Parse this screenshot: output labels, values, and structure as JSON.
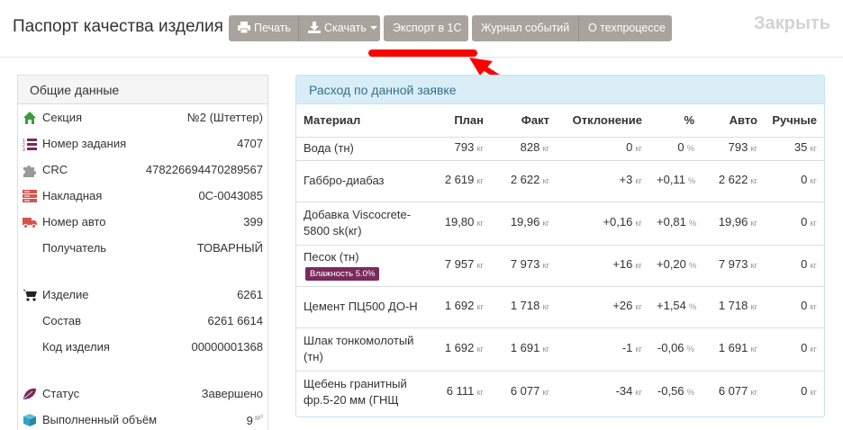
{
  "header": {
    "title": "Паспорт качества изделия",
    "print_label": "Печать",
    "download_label": "Скачать",
    "export_label": "Экспорт в 1С",
    "journal_label": "Журнал событий",
    "about_label": "О техпроцессе",
    "close_label": "Закрыть"
  },
  "general": {
    "title": "Общие данные",
    "rows": [
      {
        "label": "Секция",
        "value": "№2 (Штеттер)",
        "icon": "home-icon"
      },
      {
        "label": "Номер задания",
        "value": "4707",
        "icon": "numbered-list-icon"
      },
      {
        "label": "CRC",
        "value": "478226694470289567",
        "icon": "puzzle-icon"
      },
      {
        "label": "Накладная",
        "value": "0С-0043085",
        "icon": "server-icon"
      },
      {
        "label": "Номер авто",
        "value": "399",
        "icon": "truck-icon"
      },
      {
        "label": "Получатель",
        "value": "ТОВАРНЫЙ",
        "icon": ""
      },
      {
        "label": "Изделие",
        "value": "6261",
        "icon": "cart-icon"
      },
      {
        "label": "Состав",
        "value": "6261 6614",
        "icon": ""
      },
      {
        "label": "Код изделия",
        "value": "00000001368",
        "icon": ""
      },
      {
        "label": "Статус",
        "value": "Завершено",
        "icon": "leaf-icon"
      },
      {
        "label": "Выполненный объём",
        "value": "9",
        "unit": "м³",
        "icon": "cube-icon"
      }
    ]
  },
  "consumption": {
    "title": "Расход по данной заявке",
    "columns": [
      "Материал",
      "План",
      "Факт",
      "Отклонение",
      "%",
      "Авто",
      "Ручные"
    ],
    "unit": "кг",
    "pct_unit": "%",
    "rows": [
      {
        "name": "Вода (тн)",
        "badge": "",
        "plan": "793",
        "fact": "828",
        "dev": "0",
        "pct": "0",
        "auto": "793",
        "manual": "35"
      },
      {
        "name": "Габбро-диабаз",
        "badge": "",
        "plan": "2 619",
        "fact": "2 622",
        "dev": "+3",
        "pct": "+0,11",
        "auto": "2 622",
        "manual": "0"
      },
      {
        "name": "Добавка Viscocrete-5800 sk(кг)",
        "badge": "",
        "plan": "19,80",
        "fact": "19,96",
        "dev": "+0,16",
        "pct": "+0,81",
        "auto": "19,96",
        "manual": "0"
      },
      {
        "name": "Песок (тн)",
        "badge": "Влажность 5.0%",
        "plan": "7 957",
        "fact": "7 973",
        "dev": "+16",
        "pct": "+0,20",
        "auto": "7 973",
        "manual": "0"
      },
      {
        "name": "Цемент ПЦ500 ДО-Н",
        "badge": "",
        "plan": "1 692",
        "fact": "1 718",
        "dev": "+26",
        "pct": "+1,54",
        "auto": "1 718",
        "manual": "0"
      },
      {
        "name": "Шлак тонкомолотый (тн)",
        "badge": "",
        "plan": "1 692",
        "fact": "1 691",
        "dev": "-1",
        "pct": "-0,06",
        "auto": "1 691",
        "manual": "0"
      },
      {
        "name": "Щебень гранитный фр.5-20 мм (ГНЩ",
        "badge": "",
        "plan": "6 111",
        "fact": "6 077",
        "dev": "-34",
        "pct": "-0,56",
        "auto": "6 077",
        "manual": "0"
      }
    ]
  },
  "colors": {
    "button_bg": "#a8a39d",
    "panel_info_bg": "#d9edf7",
    "panel_info_text": "#31708f",
    "badge_bg": "#7a2a5c",
    "annotation": "#ff0000"
  }
}
